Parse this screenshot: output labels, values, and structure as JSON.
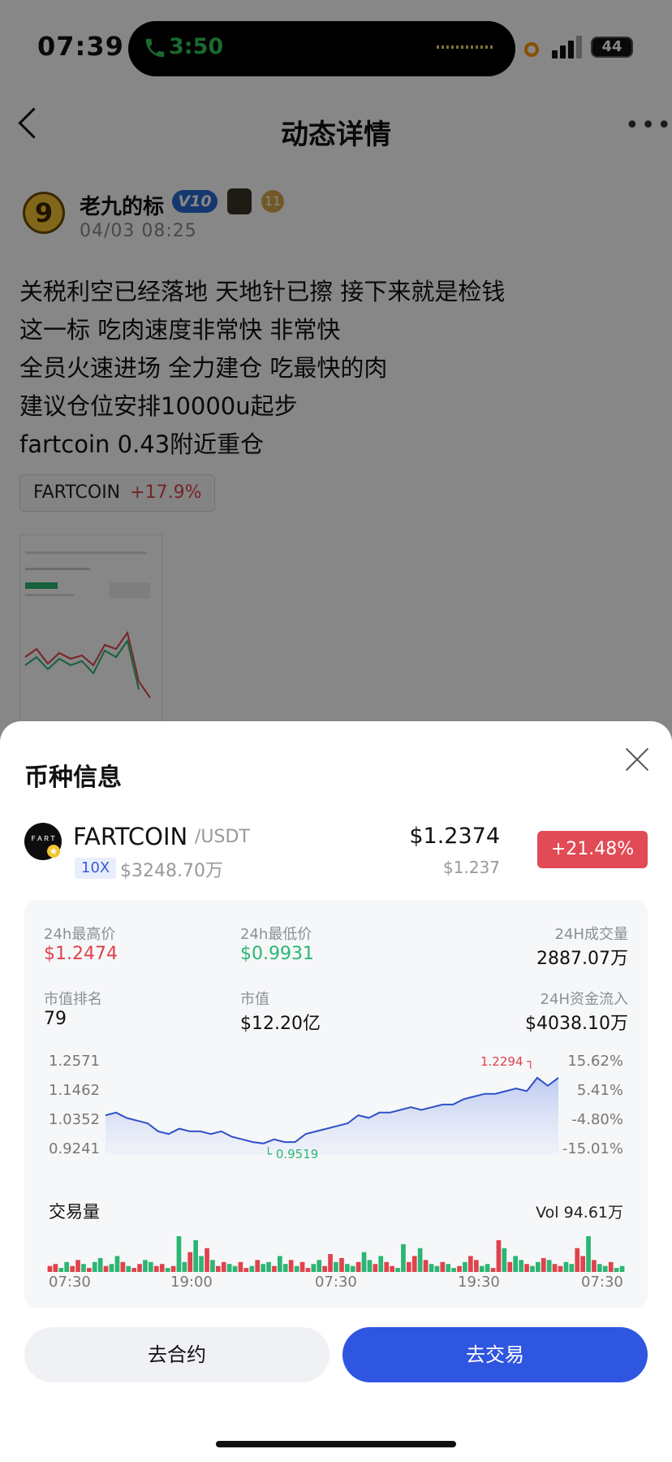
{
  "status_bar": {
    "time": "07:39",
    "call_time": "3:50",
    "battery": "44"
  },
  "nav": {
    "title": "动态详情"
  },
  "post": {
    "author": "老九的标",
    "avatar_char": "9",
    "vip_badge": "V10",
    "level_badge": "11",
    "time": "04/03 08:25",
    "lines": [
      "关税利空已经落地 天地针已擦  接下来就是检钱",
      "这一标 吃肉速度非常快 非常快",
      "全员火速进场 全力建仓 吃最快的肉",
      "建议仓位安排10000u起步",
      "fartcoin 0.43附近重仓"
    ],
    "tag": {
      "symbol": "FARTCOIN",
      "change": "+17.9%"
    }
  },
  "sheet": {
    "title": "币种信息",
    "coin": {
      "symbol": "FARTCOIN",
      "pair": "/USDT",
      "leverage": "10X",
      "market_cap_small": "$3248.70万",
      "price": "$1.2374",
      "price_sub": "$1.237",
      "change": "+21.48%"
    },
    "stats": {
      "high_label": "24h最高价",
      "high_value": "$1.2474",
      "low_label": "24h最低价",
      "low_value": "$0.9931",
      "volume_label": "24H成交量",
      "volume_value": "2887.07万",
      "rank_label": "市值排名",
      "rank_value": "79",
      "mcap_label": "市值",
      "mcap_value": "$12.20亿",
      "flow_label": "24H资金流入",
      "flow_value": "$4038.10万"
    },
    "price_chart": {
      "y_labels": [
        "1.2571",
        "1.1462",
        "1.0352",
        "0.9241"
      ],
      "pct_labels": [
        "15.62%",
        "5.41%",
        "-4.80%",
        "-15.01%"
      ],
      "high_marker": "1.2294",
      "low_marker": "0.9519"
    },
    "volume": {
      "title": "交易量",
      "value": "Vol 94.61万",
      "x_labels": [
        "07:30",
        "19:00",
        "07:30",
        "19:30",
        "07:30"
      ]
    },
    "buttons": {
      "contract": "去合约",
      "trade": "去交易"
    }
  },
  "chart_data": {
    "type": "line",
    "title": "",
    "ylim": [
      0.9241,
      1.2571
    ],
    "series": [
      {
        "name": "price",
        "values": [
          1.06,
          1.07,
          1.05,
          1.04,
          1.03,
          1.0,
          0.99,
          1.01,
          1.0,
          1.0,
          0.99,
          1.0,
          0.98,
          0.97,
          0.96,
          0.955,
          0.97,
          0.96,
          0.96,
          0.99,
          1.0,
          1.01,
          1.02,
          1.03,
          1.06,
          1.05,
          1.07,
          1.07,
          1.08,
          1.09,
          1.08,
          1.09,
          1.1,
          1.1,
          1.12,
          1.13,
          1.14,
          1.14,
          1.15,
          1.16,
          1.15,
          1.2,
          1.17,
          1.2
        ]
      }
    ],
    "volume_series": {
      "name": "交易量",
      "values": [
        3,
        4,
        2,
        5,
        3,
        6,
        4,
        2,
        5,
        7,
        3,
        4,
        8,
        5,
        3,
        2,
        4,
        6,
        5,
        3,
        4,
        2,
        3,
        18,
        5,
        10,
        16,
        8,
        12,
        6,
        3,
        5,
        4,
        3,
        5,
        2,
        3,
        6,
        4,
        5,
        3,
        8,
        4,
        6,
        3,
        5,
        2,
        4,
        6,
        3,
        9,
        5,
        7,
        4,
        3,
        5,
        10,
        6,
        4,
        8,
        5,
        3,
        2,
        14,
        5,
        8,
        12,
        6,
        4,
        3,
        5,
        4,
        2,
        3,
        5,
        8,
        6,
        3,
        4,
        2,
        16,
        12,
        5,
        8,
        6,
        4,
        3,
        5,
        7,
        6,
        4,
        3,
        5,
        4,
        12,
        8,
        18,
        6,
        4,
        3,
        5,
        2,
        3
      ]
    }
  }
}
